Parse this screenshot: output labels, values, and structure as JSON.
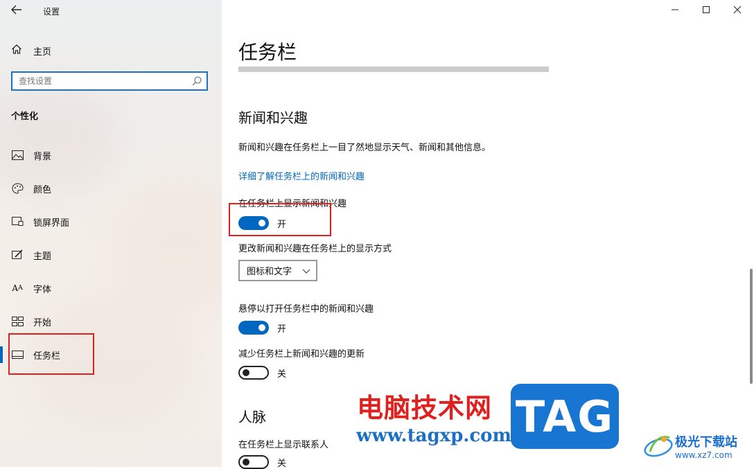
{
  "window": {
    "title": "设置",
    "back_icon": "back-arrow-icon",
    "controls": [
      "minimize-icon",
      "maximize-icon",
      "close-icon"
    ]
  },
  "sidebar": {
    "home_label": "主页",
    "search": {
      "placeholder": "查找设置",
      "value": ""
    },
    "section_title": "个性化",
    "items": [
      {
        "label": "背景",
        "icon": "image-icon",
        "active": false
      },
      {
        "label": "颜色",
        "icon": "palette-icon",
        "active": false
      },
      {
        "label": "锁屏界面",
        "icon": "lock-screen-icon",
        "active": false
      },
      {
        "label": "主题",
        "icon": "theme-brush-icon",
        "active": false
      },
      {
        "label": "字体",
        "icon": "font-icon",
        "active": false
      },
      {
        "label": "开始",
        "icon": "start-tiles-icon",
        "active": false
      },
      {
        "label": "任务栏",
        "icon": "taskbar-icon",
        "active": true
      }
    ]
  },
  "main": {
    "page_title": "任务栏",
    "news_section": {
      "heading": "新闻和兴趣",
      "description": "新闻和兴趣在任务栏上一目了然地显示天气、新闻和其他信息。",
      "link": "详细了解任务栏上的新闻和兴趣",
      "show_toggle": {
        "label": "在任务栏上显示新闻和兴趣",
        "state_text": "开",
        "on": true
      },
      "display_mode": {
        "label": "更改新闻和兴趣在任务栏上的显示方式",
        "selected": "图标和文字"
      },
      "hover_toggle": {
        "label": "悬停以打开任务栏中的新闻和兴趣",
        "state_text": "开",
        "on": true
      },
      "reduce_toggle": {
        "label": "减少任务栏上新闻和兴趣的更新",
        "state_text": "关",
        "on": false
      }
    },
    "people_section": {
      "heading": "人脉",
      "contacts_toggle": {
        "label": "在任务栏上显示联系人",
        "state_text": "关",
        "on": false
      }
    }
  },
  "colors": {
    "accent": "#0067c0",
    "highlight_box": "#e0201e"
  },
  "watermark": {
    "site_cn": "电脑技术网",
    "site_url": "www.tagxp.com",
    "tag": "TAG",
    "brand2": "极光下载站",
    "brand2_url": "www.xz7.com"
  }
}
